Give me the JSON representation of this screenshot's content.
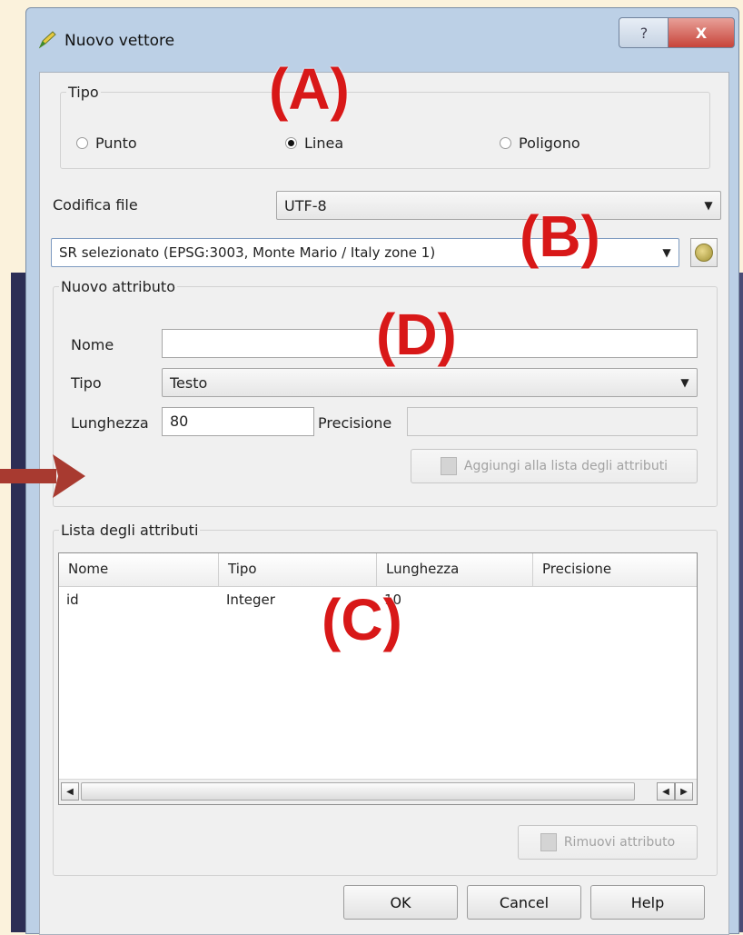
{
  "window": {
    "title": "Nuovo vettore",
    "help_glyph": "?",
    "close_glyph": "X",
    "icon": "pen-icon"
  },
  "tipo_group": {
    "legend": "Tipo",
    "options": [
      {
        "label": "Punto",
        "checked": false
      },
      {
        "label": "Linea",
        "checked": true
      },
      {
        "label": "Poligono",
        "checked": false
      }
    ]
  },
  "encoding": {
    "label": "Codifica file",
    "value": "UTF-8"
  },
  "crs": {
    "value": "SR selezionato (EPSG:3003, Monte Mario / Italy zone 1)",
    "button_icon": "globe-icon"
  },
  "new_attribute": {
    "legend": "Nuovo attributo",
    "name_label": "Nome",
    "name_value": "",
    "type_label": "Tipo",
    "type_value": "Testo",
    "length_label": "Lunghezza",
    "length_value": "80",
    "precision_label": "Precisione",
    "precision_value": "",
    "add_button": "Aggiungi alla lista degli attributi"
  },
  "attribute_list": {
    "legend": "Lista degli attributi",
    "columns": [
      "Nome",
      "Tipo",
      "Lunghezza",
      "Precisione"
    ],
    "rows": [
      {
        "nome": "id",
        "tipo": "Integer",
        "lunghezza": "10",
        "precisione": ""
      }
    ],
    "remove_button": "Rimuovi attributo"
  },
  "buttons": {
    "ok": "OK",
    "cancel": "Cancel",
    "help": "Help"
  },
  "annotations": {
    "a": "(A)",
    "b": "(B)",
    "c": "(C)",
    "d": "(D)",
    "color": "#d81818"
  },
  "arrow_color": "#a83a30"
}
